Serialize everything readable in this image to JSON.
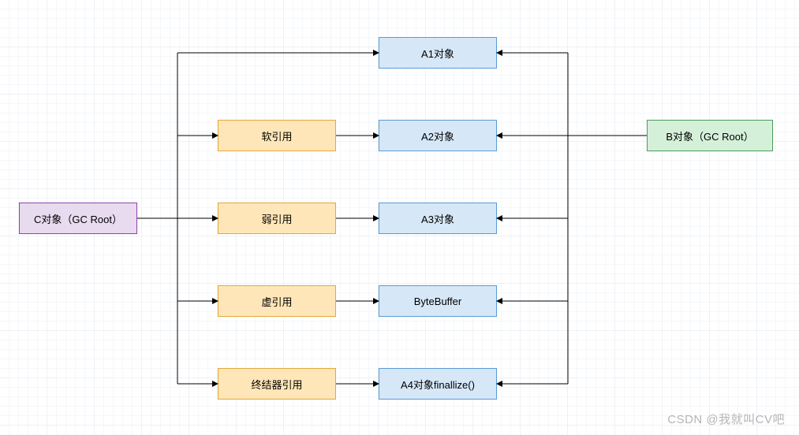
{
  "nodes": {
    "c_root": {
      "label": "C对象（GC Root）"
    },
    "b_root": {
      "label": "B对象（GC Root）"
    },
    "ref_soft": {
      "label": "软引用"
    },
    "ref_weak": {
      "label": "弱引用"
    },
    "ref_phantom": {
      "label": "虚引用"
    },
    "ref_final": {
      "label": "终结器引用"
    },
    "a1": {
      "label": "A1对象"
    },
    "a2": {
      "label": "A2对象"
    },
    "a3": {
      "label": "A3对象"
    },
    "bb": {
      "label": "ByteBuffer"
    },
    "a4": {
      "label": "A4对象finallize()"
    }
  },
  "watermark": "CSDN @我就叫CV吧",
  "colors": {
    "arrow": "#000000"
  }
}
